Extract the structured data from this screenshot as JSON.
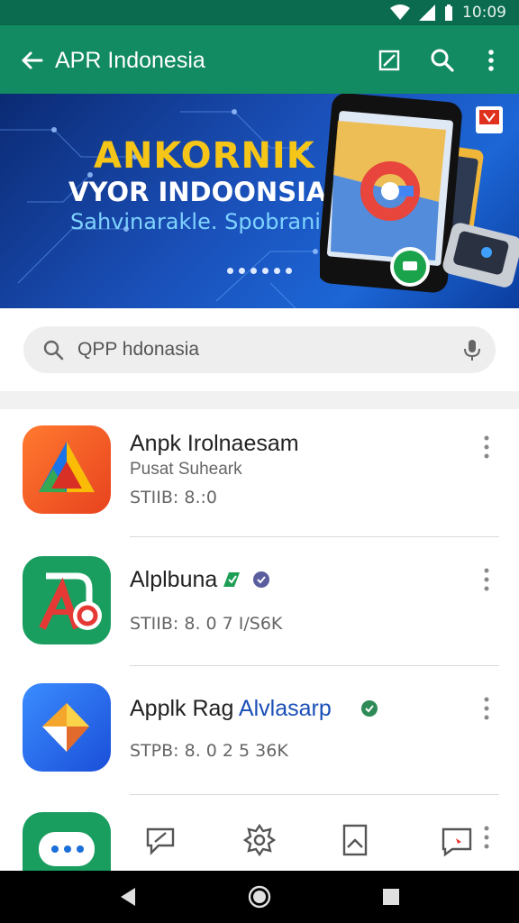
{
  "status_bar": {
    "time": "10:09"
  },
  "app_bar": {
    "title": "APR Indonesia",
    "icons": [
      "back-arrow-icon",
      "edit-icon",
      "search-icon",
      "more-vert-icon"
    ]
  },
  "banner": {
    "headline": "ANKORNIK",
    "subheadline": "VYOR INDOONSIA",
    "tagline": "Sahvinarakle. Spobranian",
    "page_dots": 6
  },
  "search": {
    "value": "QPP hdonasia"
  },
  "colors": {
    "app_bar": "#128b62",
    "status_bar": "#0b6b4f",
    "accent_blue": "#1a4fb7",
    "banner": "#1a4fb7"
  },
  "list": {
    "items": [
      {
        "title": "Anpk Irolnaesam",
        "title_accent": "",
        "subtitle": "Pusat Suheark",
        "meta": "STIIB: 8.:0",
        "badge": ""
      },
      {
        "title": "Alplbuna",
        "title_accent": "",
        "subtitle": "",
        "meta": "STIIB: 8. 0 7 I/S6K",
        "badge": "verified-icon"
      },
      {
        "title": "Applk Rag ",
        "title_accent": "Alvlasarp",
        "subtitle": "",
        "meta": "STPB: 8. 0 2 5 36K",
        "badge": "verified-icon"
      }
    ]
  },
  "bottom_tabs": [
    "feedback-icon",
    "settings-icon",
    "bookmark-icon",
    "message-icon"
  ]
}
